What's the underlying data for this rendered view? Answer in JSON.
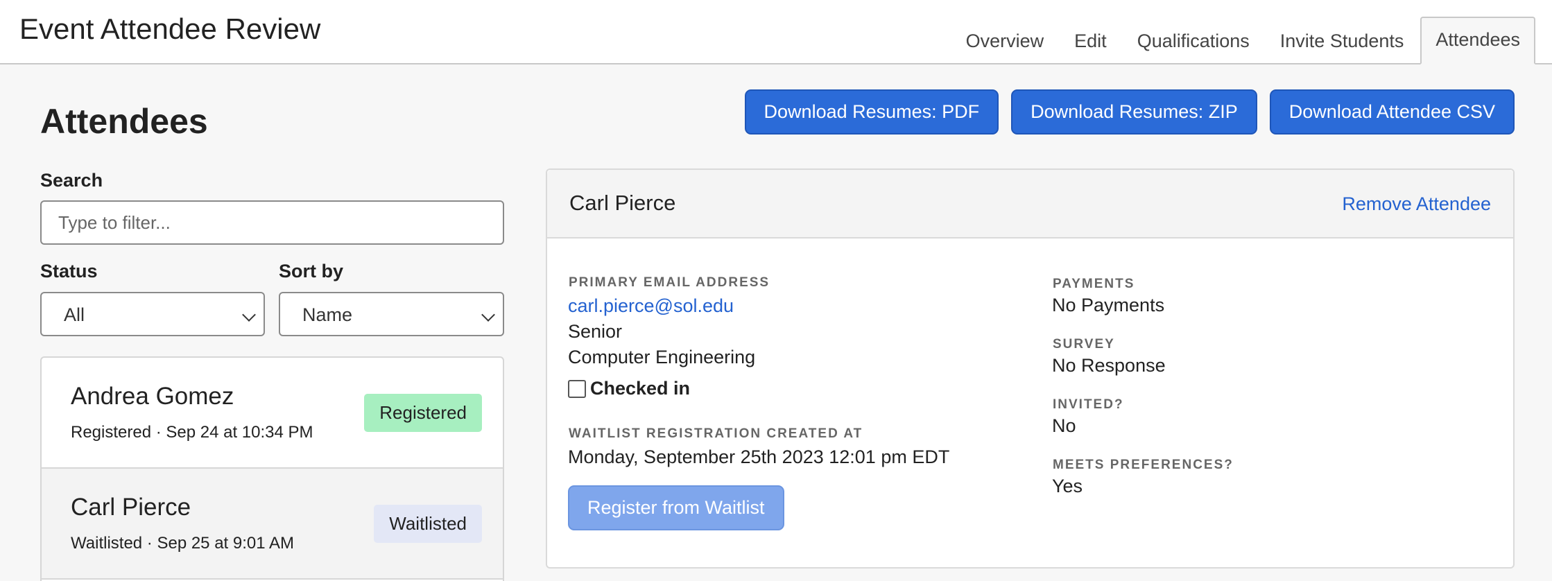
{
  "header": {
    "title": "Event Attendee Review",
    "tabs": [
      {
        "label": "Overview"
      },
      {
        "label": "Edit"
      },
      {
        "label": "Qualifications"
      },
      {
        "label": "Invite Students"
      },
      {
        "label": "Attendees"
      }
    ],
    "active_tab": "Attendees"
  },
  "page": {
    "heading": "Attendees"
  },
  "actions": {
    "pdf_label": "Download Resumes: PDF",
    "zip_label": "Download Resumes: ZIP",
    "csv_label": "Download Attendee CSV"
  },
  "filters": {
    "search_label": "Search",
    "search_placeholder": "Type to filter...",
    "search_value": "",
    "status_label": "Status",
    "status_value": "All",
    "sort_label": "Sort by",
    "sort_value": "Name"
  },
  "attendees": [
    {
      "name": "Andrea Gomez",
      "subtitle": "Registered · Sep 24 at 10:34 PM",
      "status": "Registered"
    },
    {
      "name": "Carl Pierce",
      "subtitle": "Waitlisted · Sep 25 at 9:01 AM",
      "status": "Waitlisted"
    }
  ],
  "detail": {
    "name": "Carl Pierce",
    "remove_label": "Remove Attendee",
    "email_label": "PRIMARY EMAIL ADDRESS",
    "email": "carl.pierce@sol.edu",
    "year": "Senior",
    "major": "Computer Engineering",
    "checked_in_label": "Checked in",
    "checked_in": false,
    "waitlist_created_label": "WAITLIST REGISTRATION CREATED AT",
    "waitlist_created": "Monday, September 25th 2023 12:01 pm EDT",
    "register_button": "Register from Waitlist",
    "payments_label": "PAYMENTS",
    "payments": "No Payments",
    "survey_label": "SURVEY",
    "survey": "No Response",
    "invited_label": "INVITED?",
    "invited": "No",
    "meets_label": "MEETS PREFERENCES?",
    "meets": "Yes"
  },
  "colors": {
    "primary": "#2b6bd8",
    "link": "#2462d0",
    "registered_badge": "#a7efc0",
    "waitlisted_badge": "#e3e7f6"
  }
}
